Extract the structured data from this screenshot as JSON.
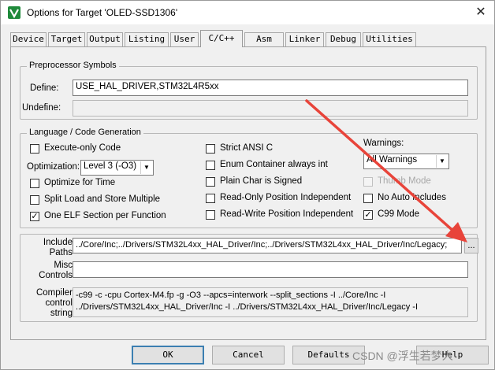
{
  "window": {
    "title": "Options for Target 'OLED-SSD1306'",
    "close_icon": "close-icon",
    "app_icon": "keil-uvision-icon"
  },
  "tabs": [
    {
      "label": "Device"
    },
    {
      "label": "Target"
    },
    {
      "label": "Output"
    },
    {
      "label": "Listing"
    },
    {
      "label": "User"
    },
    {
      "label": "C/C++",
      "active": true
    },
    {
      "label": "Asm"
    },
    {
      "label": "Linker"
    },
    {
      "label": "Debug"
    },
    {
      "label": "Utilities"
    }
  ],
  "preprocessor": {
    "title": "Preprocessor Symbols",
    "define_label": "Define:",
    "define_value": "USE_HAL_DRIVER,STM32L4R5xx",
    "undefine_label": "Undefine:",
    "undefine_value": ""
  },
  "language": {
    "title": "Language / Code Generation",
    "options": {
      "execute_only": {
        "label": "Execute-only Code",
        "checked": false
      },
      "optimize_time": {
        "label": "Optimize for Time",
        "checked": false
      },
      "split_load": {
        "label": "Split Load and Store Multiple",
        "checked": false
      },
      "one_elf": {
        "label": "One ELF Section per Function",
        "checked": true
      },
      "strict_ansi": {
        "label": "Strict ANSI C",
        "checked": false
      },
      "enum_container": {
        "label": "Enum Container always int",
        "checked": false
      },
      "plain_char": {
        "label": "Plain Char is Signed",
        "checked": false
      },
      "ro_pos": {
        "label": "Read-Only Position Independent",
        "checked": false
      },
      "rw_pos": {
        "label": "Read-Write Position Independent",
        "checked": false
      },
      "thumb_mode": {
        "label": "Thumb Mode",
        "checked": false,
        "disabled": true
      },
      "no_auto_includes": {
        "label": "No Auto Includes",
        "checked": false
      },
      "c99_mode": {
        "label": "C99 Mode",
        "checked": true
      }
    },
    "optimization_label": "Optimization:",
    "optimization_value": "Level 3 (-O3)",
    "warnings_label": "Warnings:",
    "warnings_value": "All Warnings"
  },
  "include": {
    "label_line1": "Include",
    "label_line2": "Paths",
    "value": "../Core/Inc;../Drivers/STM32L4xx_HAL_Driver/Inc;../Drivers/STM32L4xx_HAL_Driver/Inc/Legacy;",
    "browse_label": "..."
  },
  "misc": {
    "label_line1": "Misc",
    "label_line2": "Controls",
    "value": ""
  },
  "compiler": {
    "label_line1": "Compiler",
    "label_line2": "control",
    "label_line3": "string",
    "line1": "-c99 -c -cpu Cortex-M4.fp -g -O3 --apcs=interwork --split_sections -I ../Core/Inc -I",
    "line2": "../Drivers/STM32L4xx_HAL_Driver/Inc -I ../Drivers/STM32L4xx_HAL_Driver/Inc/Legacy -I"
  },
  "buttons": {
    "ok": "OK",
    "cancel": "Cancel",
    "defaults": "Defaults",
    "help": "Help"
  },
  "watermark": "CSDN @浮生若梦人",
  "colors": {
    "annotation_arrow": "#e8443a",
    "focus_border": "#3c7fb1"
  }
}
